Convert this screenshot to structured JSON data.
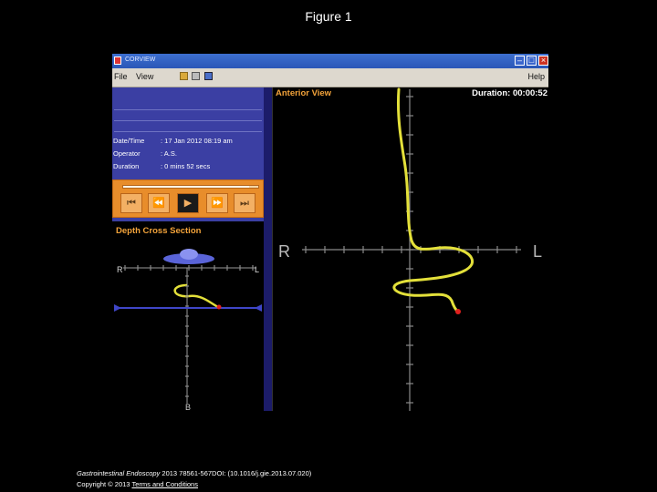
{
  "slide_title": "Figure 1",
  "window": {
    "app_title": "CORVIEW",
    "menu": {
      "file": "File",
      "view": "View",
      "help": "Help"
    }
  },
  "info_panel": {
    "rows": [
      {
        "label": "Date/Time",
        "value": ": 17 Jan 2012   08:19 am"
      },
      {
        "label": "Operator",
        "value": ": A.S."
      },
      {
        "label": "Duration",
        "value": ": 0 mins  52 secs"
      }
    ]
  },
  "playback": {
    "progress": 0.93,
    "buttons": [
      "skip-back",
      "rewind",
      "play",
      "fast-forward",
      "skip-forward"
    ]
  },
  "depth_panel": {
    "title": "Depth Cross Section",
    "label_r": "R",
    "label_l": "L",
    "label_b": "B"
  },
  "anterior_view": {
    "title": "Anterior View",
    "duration": "Duration: 00:00:52",
    "label_r": "R",
    "label_l": "L"
  },
  "colors": {
    "trace": "#e3e03a",
    "endpoint": "#e0201e",
    "panel_accent": "#f3a33a"
  },
  "footer": {
    "citation": "Gastrointestinal Endoscopy 2013 78561-567DOI: (10.1016/j.gie.2013.07.020)",
    "journal": "Gastrointestinal Endoscopy",
    "rest": " 2013 78561-567DOI: (10.1016/j.gie.2013.07.020)",
    "copyright": "Copyright © 2013 ",
    "terms": "Terms and Conditions"
  }
}
